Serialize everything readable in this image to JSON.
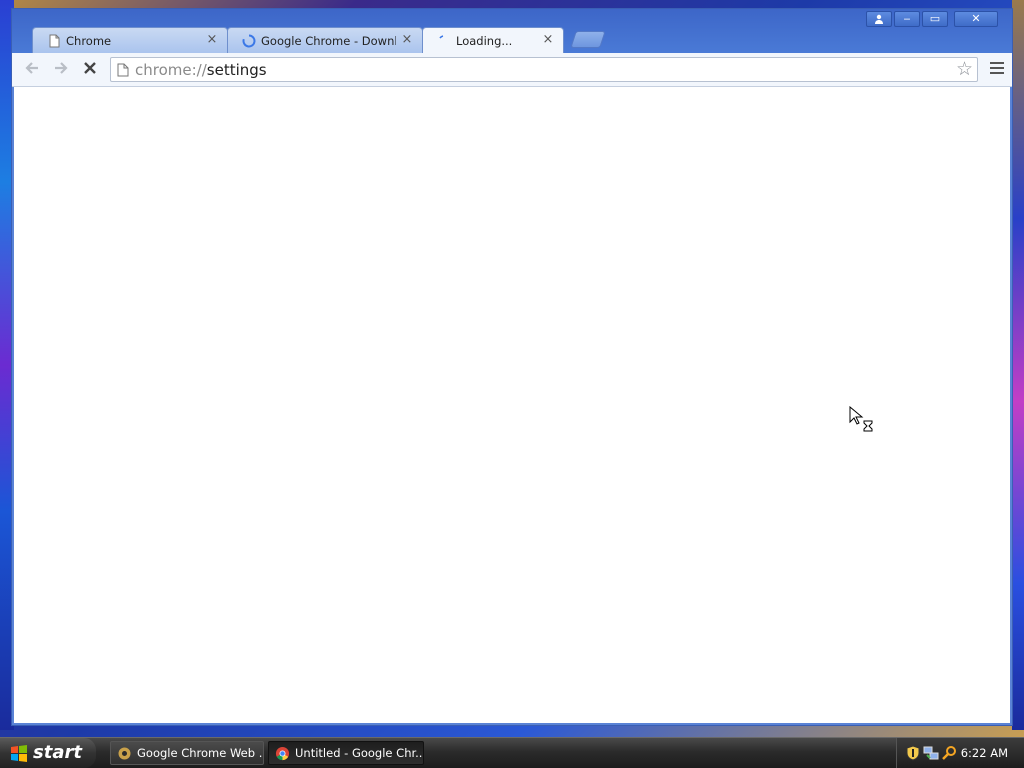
{
  "window": {
    "tabs": [
      {
        "title": "Chrome",
        "icon": "page-icon",
        "active": false
      },
      {
        "title": "Google Chrome - Download t",
        "icon": "loading-spinner-icon",
        "active": false
      },
      {
        "title": "Loading...",
        "icon": "loading-spinner-icon",
        "active": true
      }
    ],
    "tab_close_glyph": "×",
    "controls": {
      "minimize": "‒",
      "maximize": "▭",
      "close": "✕"
    }
  },
  "toolbar": {
    "address_scheme": "chrome://",
    "address_path": "settings"
  },
  "taskbar": {
    "start_label": "start",
    "buttons": [
      {
        "label": "Google Chrome Web ...",
        "active": false
      },
      {
        "label": "Untitled - Google Chr...",
        "active": true
      }
    ],
    "clock": "6:22 AM"
  },
  "colors": {
    "tab_active": "#f2f6fc",
    "titlebar": "#4a7ad6",
    "taskbar": "#2b2b2b"
  }
}
